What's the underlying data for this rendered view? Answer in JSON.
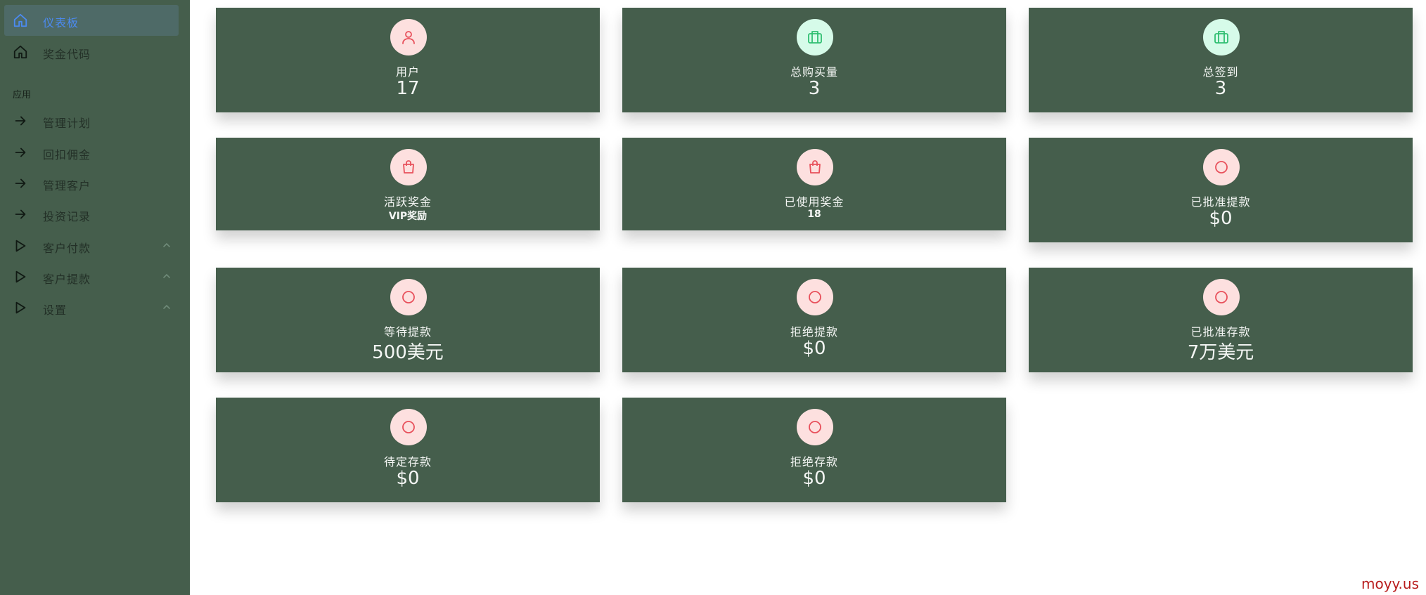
{
  "sidebar": {
    "dashboard": "仪表板",
    "bonus_code": "奖金代码",
    "section_apps": "应用",
    "items": [
      "管理计划",
      "回扣佣金",
      "管理客户",
      "投资记录"
    ],
    "groups": [
      "客户付款",
      "客户提款",
      "设置"
    ]
  },
  "icons": {
    "user": "user-icon",
    "briefcase": "briefcase-icon",
    "bag": "shopping-bag-icon",
    "circle": "circle-icon",
    "home": "home-icon",
    "arrow": "arrow-right-icon",
    "play": "play-icon",
    "chevron": "chevron-up-icon"
  },
  "colors": {
    "sidebar": "#455e4c",
    "card": "#455e4c",
    "pink_bg": "#fde0df",
    "pink_icon": "#e8505b",
    "mint_bg": "#d6fbe9",
    "mint_icon": "#2fbf71",
    "active_text": "#4b8af0"
  },
  "cards": [
    {
      "title": "用户",
      "value": "17"
    },
    {
      "title": "总购买量",
      "value": "3"
    },
    {
      "title": "总签到",
      "value": "3"
    },
    {
      "title": "活跃奖金",
      "value": "VIP奖励"
    },
    {
      "title": "已使用奖金",
      "value": "18"
    },
    {
      "title": "已批准提款",
      "value": "$0"
    },
    {
      "title": "等待提款",
      "value": "500美元"
    },
    {
      "title": "拒绝提款",
      "value": "$0"
    },
    {
      "title": "已批准存款",
      "value": "7万美元"
    },
    {
      "title": "待定存款",
      "value": "$0"
    },
    {
      "title": "拒绝存款",
      "value": "$0"
    }
  ],
  "watermark": "moyy.us"
}
